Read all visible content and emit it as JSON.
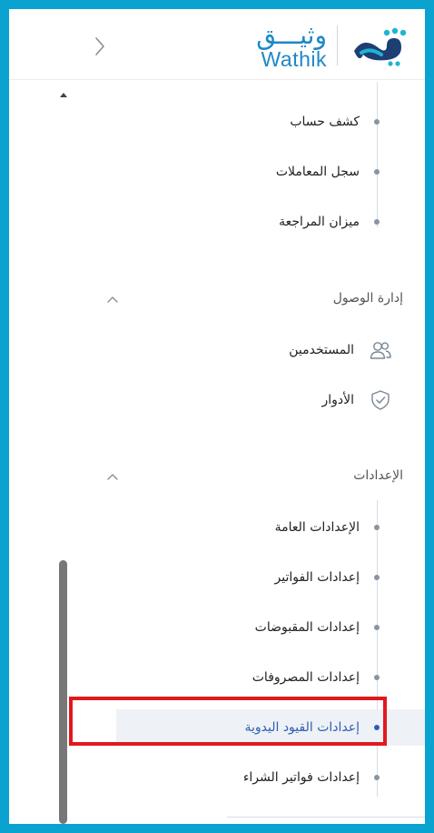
{
  "app": {
    "logo_ar": "وثيـــق",
    "logo_en": "Wathik",
    "logo_icon": "wathik-logo-mark",
    "accent": "#1d88c7",
    "frame_color": "#0aa2cf",
    "highlight_color": "#e0191f"
  },
  "nav": {
    "reports_items": [
      {
        "label": "كشف حساب"
      },
      {
        "label": "سجل المعاملات"
      },
      {
        "label": "ميزان المراجعة"
      }
    ],
    "access_section": {
      "title": "إدارة الوصول",
      "items": [
        {
          "label": "المستخدمين",
          "icon": "users-icon"
        },
        {
          "label": "الأدوار",
          "icon": "shield-check-icon"
        }
      ]
    },
    "settings_section": {
      "title": "الإعدادات",
      "items": [
        {
          "label": "الإعدادات العامة"
        },
        {
          "label": "إعدادات الفواتير"
        },
        {
          "label": "إعدادات المقبوضات"
        },
        {
          "label": "إعدادات المصروفات"
        },
        {
          "label": "إعدادات القيود اليدوية",
          "active": true
        },
        {
          "label": "إعدادات فواتير الشراء"
        }
      ]
    }
  }
}
